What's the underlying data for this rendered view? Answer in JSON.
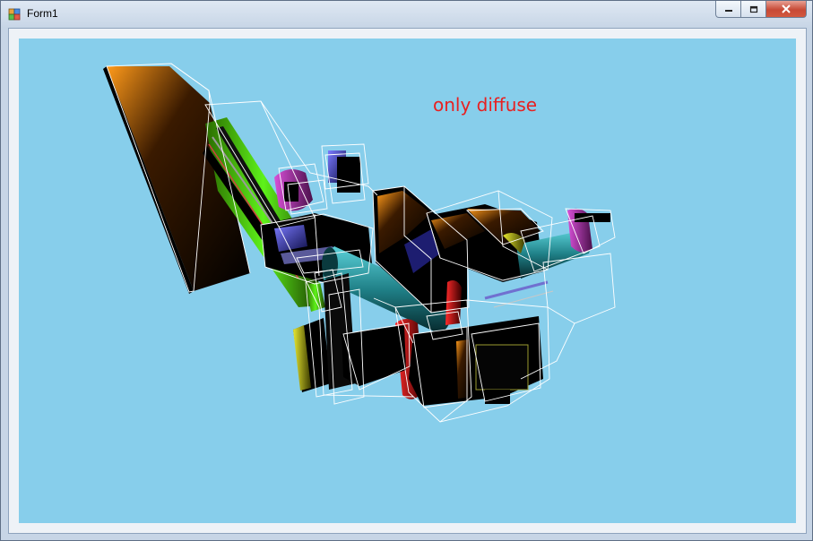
{
  "window": {
    "title": "Form1",
    "controls": {
      "minimize_icon": "minimize-icon",
      "maximize_icon": "restore-icon",
      "close_icon": "close-icon"
    }
  },
  "viewport": {
    "background_color": "#87ceeb",
    "overlay_text": "only diffuse",
    "overlay_color": "#e82020"
  },
  "scene": {
    "description_icon": "3d-model",
    "wireframe_color": "#ffffff"
  }
}
